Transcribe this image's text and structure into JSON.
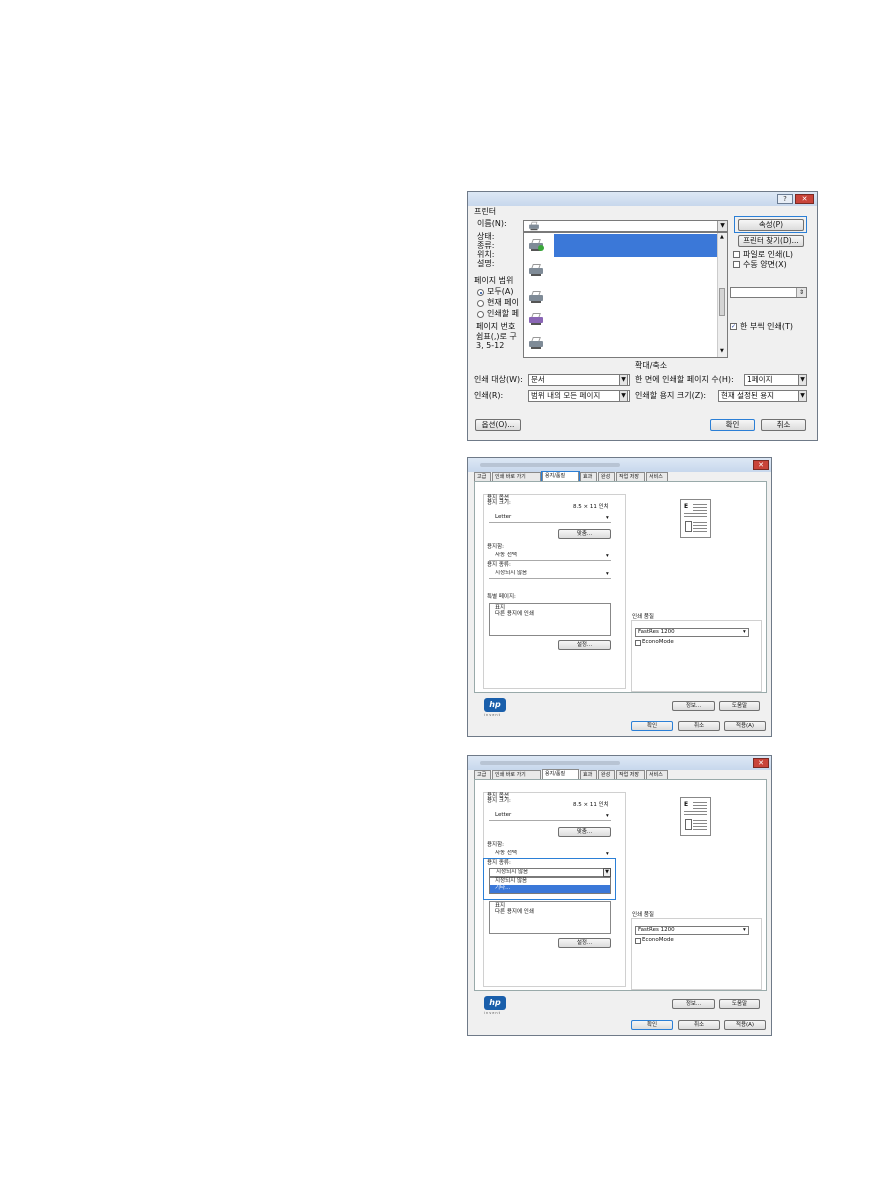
{
  "print_dialog": {
    "help_button": "?",
    "close_button": "✕",
    "printer_group": "프린터",
    "name_label": "이름(N):",
    "status_label": "상태:",
    "type_label": "종류:",
    "where_label": "위치:",
    "comment_label": "설명:",
    "properties_button": "속성(P)",
    "find_printer_button": "프린터 찾기(D)...",
    "print_to_file": "파일로 인쇄(L)",
    "manual_duplex": "수동 양면(X)",
    "page_range_group": "페이지 범위",
    "all_option": "모두(A)",
    "current_page_option": "현재 페이",
    "print_pages_option": "인쇄할 페",
    "page_number_hint1": "페이지 번호",
    "page_number_hint2": "쉼표(,)로 구",
    "page_number_hint3": "3, 5-12",
    "collate_label": "한 부씩 인쇄(T)",
    "zoom_group": "확대/축소",
    "print_what_label": "인쇄 대상(W):",
    "print_what_value": "문서",
    "pages_per_sheet_label": "한 면에 인쇄할 페이지 수(H):",
    "pages_per_sheet_value": "1페이지",
    "print_label": "인쇄(R):",
    "print_value": "범위 내의 모든 페이지",
    "scale_label": "인쇄할 용지 크기(Z):",
    "scale_value": "현재 설정된 용지",
    "options_button": "옵션(O)...",
    "ok_button": "확인",
    "cancel_button": "취소"
  },
  "props_dialog_1": {
    "close_button": "✕",
    "tabs": [
      "고급",
      "인쇄 바로 가기",
      "용지/품질",
      "효과",
      "완성",
      "작업 저장",
      "서비스"
    ],
    "paper_options_group": "용지 옵션",
    "paper_size_label": "용지 크기:",
    "paper_size_dim": "8.5 × 11 인치",
    "paper_size_value": "Letter",
    "custom_button": "맞춤...",
    "paper_source_label": "용지함:",
    "paper_source_value": "자동 선택",
    "paper_type_label": "용지 종류:",
    "paper_type_value": "지정되지 않음",
    "special_pages_label": "특별 페이지:",
    "special_pages_items": [
      "표지",
      "다른 용지에 인쇄"
    ],
    "settings_button": "설정...",
    "print_quality_group": "인쇄 품질",
    "print_quality_value": "FastRes 1200",
    "economode_label": "EconoMode",
    "hp_logo": "hp",
    "hp_tagline": "invent",
    "about_button": "정보...",
    "help_button": "도움말",
    "ok_button": "확인",
    "cancel_button": "취소",
    "apply_button": "적용(A)"
  },
  "props_dialog_2": {
    "close_button": "✕",
    "tabs": [
      "고급",
      "인쇄 바로 가기",
      "용지/품질",
      "효과",
      "완성",
      "작업 저장",
      "서비스"
    ],
    "paper_options_group": "용지 옵션",
    "paper_size_label": "용지 크기:",
    "paper_size_dim": "8.5 × 11 인치",
    "paper_size_value": "Letter",
    "custom_button": "맞춤...",
    "paper_source_label": "용지함:",
    "paper_source_value": "자동 선택",
    "paper_type_label": "용지 종류:",
    "paper_type_value": "지정되지 않음",
    "paper_type_options": [
      "지정되지 않음",
      "기타..."
    ],
    "special_pages_items": [
      "표지",
      "다른 용지에 인쇄"
    ],
    "settings_button": "설정...",
    "print_quality_group": "인쇄 품질",
    "print_quality_value": "FastRes 1200",
    "economode_label": "EconoMode",
    "hp_logo": "hp",
    "hp_tagline": "invent",
    "about_button": "정보...",
    "help_button": "도움말",
    "ok_button": "확인",
    "cancel_button": "취소",
    "apply_button": "적용(A)"
  }
}
